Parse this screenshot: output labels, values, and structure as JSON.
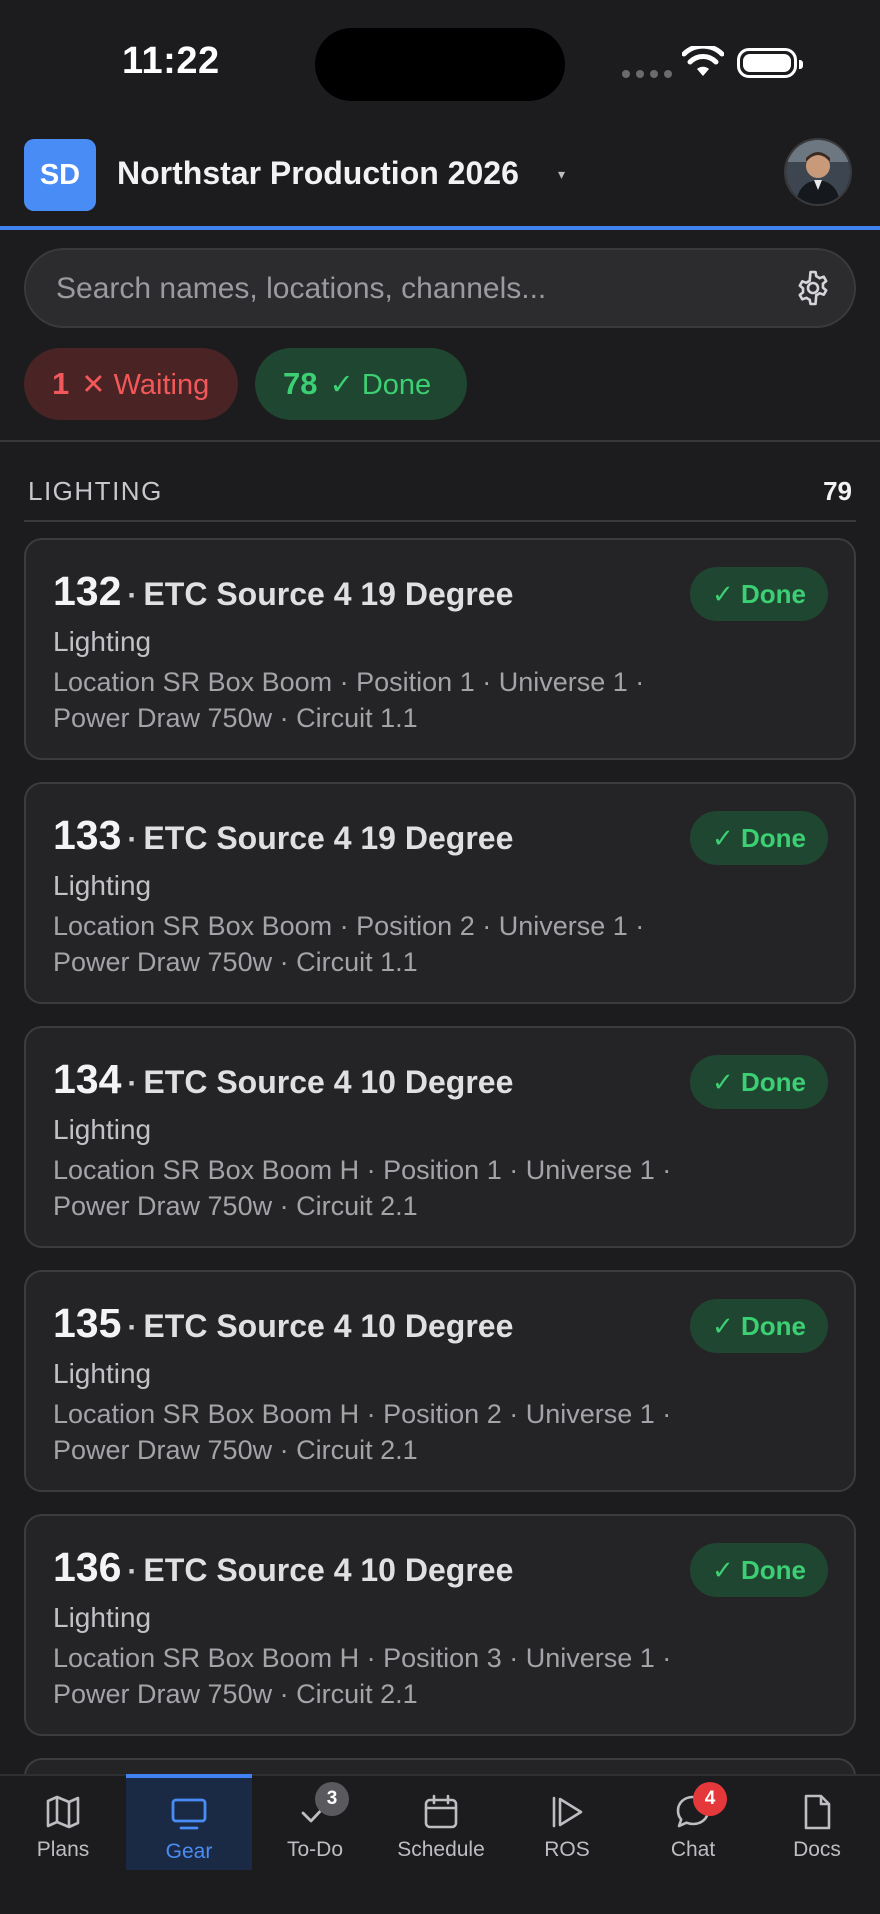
{
  "status_bar": {
    "time": "11:22"
  },
  "header": {
    "initials": "SD",
    "project_title": "Northstar Production 2026",
    "dropdown_caret": "▾"
  },
  "search": {
    "placeholder": "Search names, locations, channels..."
  },
  "filters": {
    "waiting": {
      "count": "1",
      "label": "✕ Waiting",
      "color": "#f2585a"
    },
    "done": {
      "count": "78",
      "label": "✓ Done",
      "color": "#3ccf73"
    }
  },
  "section": {
    "title": "LIGHTING",
    "count": "79"
  },
  "cards": [
    {
      "unit": "132",
      "sep": "·",
      "name": "ETC Source 4 19 Degree",
      "category": "Lighting",
      "meta": "Location SR Box Boom · Position 1 · Universe 1 · Power Draw 750w · Circuit 1.1",
      "status": "✓ Done"
    },
    {
      "unit": "133",
      "sep": "·",
      "name": "ETC Source 4 19 Degree",
      "category": "Lighting",
      "meta": "Location SR Box Boom · Position 2 · Universe 1 · Power Draw 750w · Circuit 1.1",
      "status": "✓ Done"
    },
    {
      "unit": "134",
      "sep": "·",
      "name": "ETC Source 4 10 Degree",
      "category": "Lighting",
      "meta": "Location SR Box Boom H · Position 1 · Universe 1 · Power Draw 750w · Circuit 2.1",
      "status": "✓ Done"
    },
    {
      "unit": "135",
      "sep": "·",
      "name": "ETC Source 4 10 Degree",
      "category": "Lighting",
      "meta": "Location SR Box Boom H · Position 2 · Universe 1 · Power Draw 750w · Circuit 2.1",
      "status": "✓ Done"
    },
    {
      "unit": "136",
      "sep": "·",
      "name": "ETC Source 4 10 Degree",
      "category": "Lighting",
      "meta": "Location SR Box Boom H · Position 3 · Universe 1 · Power Draw 750w · Circuit 2.1",
      "status": "✓ Done"
    }
  ],
  "tabs": [
    {
      "label": "Plans",
      "icon": "map-icon"
    },
    {
      "label": "Gear",
      "icon": "monitor-icon",
      "active": true
    },
    {
      "label": "To-Do",
      "icon": "checkmark-icon",
      "badge": "3"
    },
    {
      "label": "Schedule",
      "icon": "calendar-icon"
    },
    {
      "label": "ROS",
      "icon": "play-icon"
    },
    {
      "label": "Chat",
      "icon": "chat-bubble-icon",
      "badge": "4"
    },
    {
      "label": "Docs",
      "icon": "document-icon"
    }
  ],
  "colors": {
    "accent": "#3f82f0",
    "done": "#3ccf73",
    "waiting": "#f2585a",
    "background": "#1c1c1e"
  }
}
